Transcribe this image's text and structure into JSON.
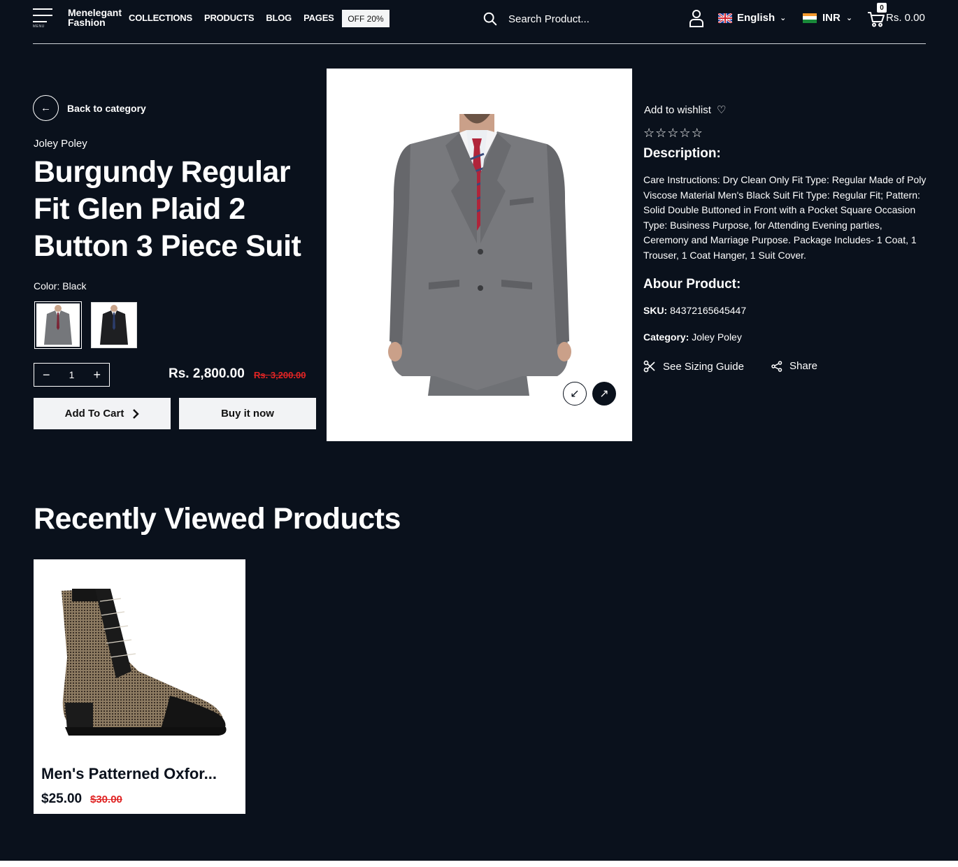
{
  "header": {
    "menu_label": "MENU",
    "logo_line1": "Menelegant",
    "logo_line2": "Fashion",
    "nav": [
      "COLLECTIONS",
      "PRODUCTS",
      "BLOG",
      "PAGES"
    ],
    "offer_badge": "OFF 20%",
    "search_placeholder": "Search Product...",
    "language": "English",
    "currency": "INR",
    "cart_count": "0",
    "cart_total": "Rs. 0.00"
  },
  "product": {
    "back_label": "Back to category",
    "brand": "Joley Poley",
    "title": "Burgundy Regular Fit Glen Plaid 2 Button 3 Piece Suit",
    "color_label": "Color: Black",
    "quantity": "1",
    "price": "Rs. 2,800.00",
    "old_price": "Rs. 3,200.00",
    "add_to_cart": "Add To Cart",
    "buy_now": "Buy it now",
    "wishlist_label": "Add to wishlist",
    "rating_stars": 0,
    "description_heading": "Description:",
    "description": "Care Instructions: Dry Clean Only Fit Type: Regular Made of Poly Viscose Material Men's Black Suit Fit Type: Regular Fit; Pattern: Solid Double Buttoned in Front with a Pocket Square Occasion Type: Business Purpose, for Attending Evening parties, Ceremony and Marriage Purpose. Package Includes- 1 Coat, 1 Trouser, 1 Coat Hanger, 1 Suit Cover.",
    "about_heading": "Abour Product:",
    "sku_label": "SKU:",
    "sku_value": "84372165645447",
    "category_label": "Category:",
    "category_value": "Joley Poley",
    "sizing_guide": "See Sizing Guide",
    "share": "Share"
  },
  "recently_viewed": {
    "heading": "Recently Viewed Products",
    "items": [
      {
        "name": "Men's Patterned Oxfor...",
        "price": "$25.00",
        "old_price": "$30.00"
      }
    ]
  },
  "colors": {
    "background": "#0a111c",
    "sale_red": "#e02424",
    "button_bg": "#f2f3f5"
  }
}
